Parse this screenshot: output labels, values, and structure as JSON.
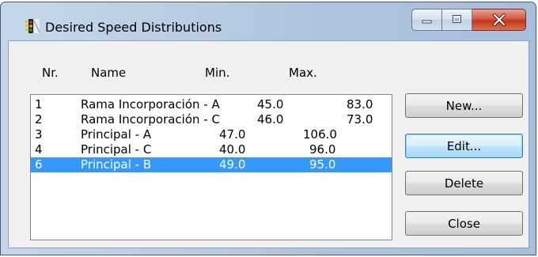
{
  "window": {
    "title": "Desired Speed Distributions"
  },
  "list": {
    "columns": [
      "Nr.",
      "Name",
      "Min.",
      "Max."
    ],
    "rows": [
      {
        "nr": "1",
        "name": "Rama Incorporación - A",
        "min": "45.0",
        "max": "83.0",
        "selected": false
      },
      {
        "nr": "2",
        "name": "Rama Incorporación - C",
        "min": "46.0",
        "max": "73.0",
        "selected": false
      },
      {
        "nr": "3",
        "name": "Principal - A",
        "min": "47.0",
        "max": "106.0",
        "selected": false
      },
      {
        "nr": "4",
        "name": "Principal - C",
        "min": "40.0",
        "max": "96.0",
        "selected": false
      },
      {
        "nr": "6",
        "name": "Principal - B",
        "min": "49.0",
        "max": "95.0",
        "selected": true
      }
    ]
  },
  "buttons": {
    "new": "New...",
    "edit": "Edit...",
    "delete": "Delete",
    "close": "Close"
  },
  "icons": {
    "app": "traffic-light-icon",
    "minimize": "minimize-icon",
    "maximize": "maximize-icon",
    "close": "close-icon"
  },
  "colors": {
    "selection": "#3399ff",
    "close_button": "#c43619",
    "titlebar": "#b9cce3"
  }
}
